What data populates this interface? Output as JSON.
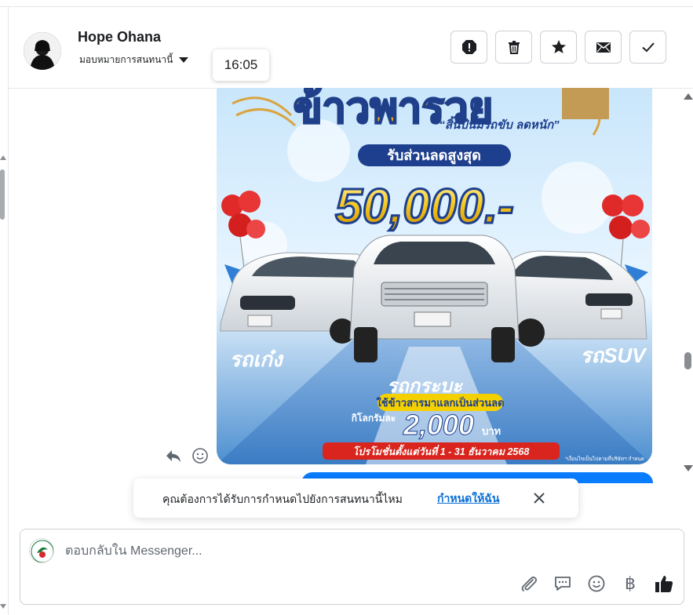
{
  "header": {
    "contact_name": "Hope Ohana",
    "assign_label": "มอบหมายการสนทนานี้",
    "time_tooltip": "16:05",
    "actions": [
      {
        "name": "spam-button",
        "icon": "alert-octagon-icon"
      },
      {
        "name": "delete-button",
        "icon": "trash-icon"
      },
      {
        "name": "star-button",
        "icon": "star-icon"
      },
      {
        "name": "mark-unread-button",
        "icon": "envelope-icon"
      },
      {
        "name": "mark-done-button",
        "icon": "checkmark-icon"
      }
    ]
  },
  "promo_image": {
    "headline": "ข้าวพารวย",
    "subheadline": "“สิ้นปีนี้มีรถขับ ลดหนัก”",
    "discount_label": "รับส่วนลดสูงสุด",
    "discount_amount": "50,000.-",
    "left_car_label": "รถเก๋ง",
    "right_car_label": "รถSUV",
    "center_car_label": "รถกระบะ",
    "rice_trade_label": "ใช้ข้าวสารมาแลกเป็นส่วนลด",
    "per_kg_label": "กิโลกรัมละ",
    "per_kg_amount": "2,000",
    "per_kg_unit": "บาท",
    "period_label": "โปรโมชั่นตั้งแต่วันที่ 1 - 31 ธันวาคม 2568",
    "footnote": "*เงื่อนไขเป็นไปตามที่บริษัทฯ กำหนด"
  },
  "assignment_banner": {
    "question": "คุณต้องการได้รับการกำหนดไปยังการสนทนานี้ไหม",
    "link": "กำหนดให้ฉัน"
  },
  "composer": {
    "placeholder": "ตอบกลับใน Messenger..."
  },
  "colors": {
    "accent_blue": "#0a7cff",
    "link_blue": "#0a6fd6",
    "border": "#ccd0d5",
    "divider": "#e4e6eb"
  }
}
